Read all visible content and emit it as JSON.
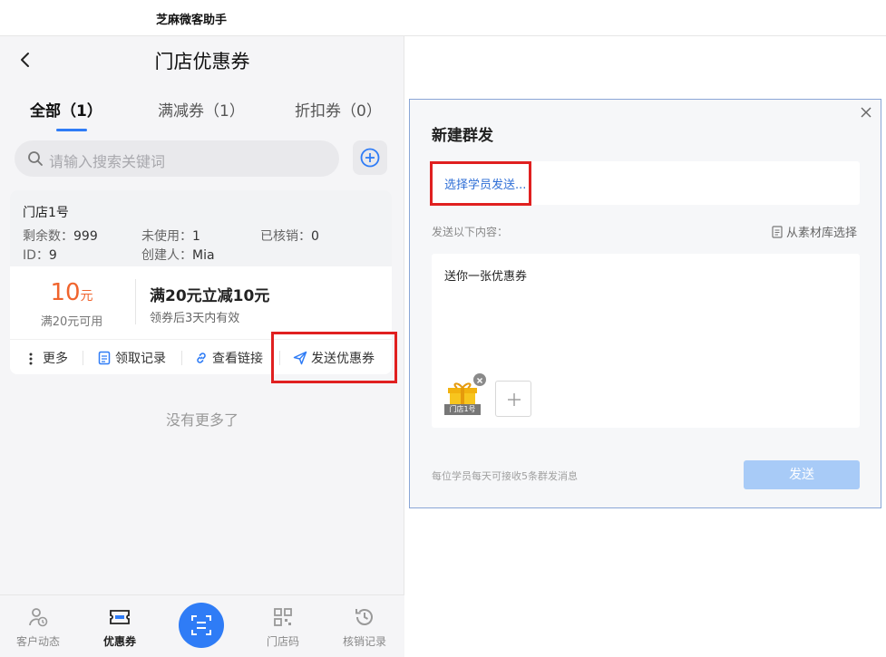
{
  "app": {
    "title": "芝麻微客助手"
  },
  "header": {
    "title": "门店优惠券"
  },
  "tabs": [
    {
      "label": "全部（1）",
      "active": true
    },
    {
      "label": "满减券（1）",
      "active": false
    },
    {
      "label": "折扣券（0）",
      "active": false
    }
  ],
  "search": {
    "placeholder": "请输入搜索关键词"
  },
  "coupon": {
    "store": "门店1号",
    "stats": {
      "remaining_label": "剩余数：",
      "remaining": "999",
      "unused_label": "未使用：",
      "unused": "1",
      "verified_label": "已核销：",
      "verified": "0",
      "id_label": "ID：",
      "id": "9",
      "creator_label": "创建人：",
      "creator": "Mia"
    },
    "amount": "10",
    "amount_unit": "元",
    "amount_condition": "满20元可用",
    "title": "满20元立减10元",
    "validity": "领券后3天内有效",
    "actions": {
      "more": "更多",
      "records": "领取记录",
      "link": "查看链接",
      "send": "发送优惠券"
    }
  },
  "list_end": "没有更多了",
  "bottom_nav": [
    {
      "label": "客户动态",
      "icon": "person-clock-icon"
    },
    {
      "label": "优惠券",
      "icon": "coupon-icon",
      "active": true
    },
    {
      "label": "门店码",
      "icon": "qr-code-icon"
    },
    {
      "label": "核销记录",
      "icon": "history-icon"
    }
  ],
  "dialog": {
    "title": "新建群发",
    "select_recipients": "选择学员发送...",
    "send_content_label": "发送以下内容：",
    "select_from_library": "从素材库选择",
    "message": "送你一张优惠券",
    "attachment_label": "门店1号",
    "footer_note": "每位学员每天可接收5条群发消息",
    "send_button": "发送"
  },
  "colors": {
    "accent": "#2f7cf6",
    "highlight": "#e02020",
    "amount": "#f0642d",
    "send_disabled": "#a8cbf7"
  }
}
